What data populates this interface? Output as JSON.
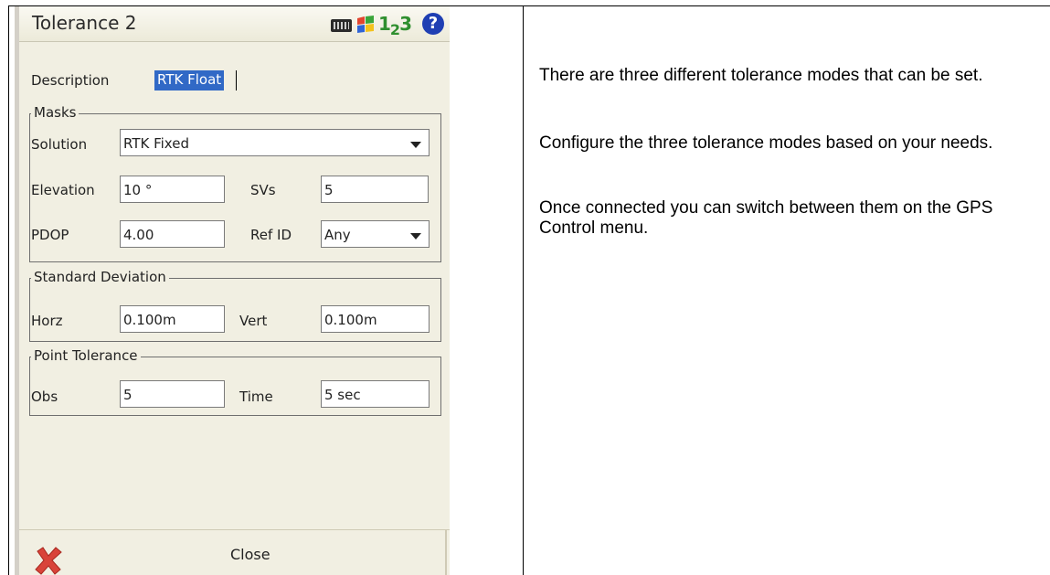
{
  "window": {
    "title": "Tolerance 2"
  },
  "status_icons": [
    "keyboard-icon",
    "windows-flag-icon",
    "input-mode-123-icon",
    "help-icon"
  ],
  "input_mode": {
    "main": "1",
    "sub": "2",
    "tail": "3"
  },
  "help_glyph": "?",
  "description": {
    "label": "Description",
    "value": "RTK Float"
  },
  "masks": {
    "title": "Masks",
    "solution_label": "Solution",
    "solution_value": "RTK Fixed",
    "elevation_label": "Elevation",
    "elevation_value": "10 °",
    "svs_label": "SVs",
    "svs_value": "5",
    "pdop_label": "PDOP",
    "pdop_value": "4.00",
    "refid_label": "Ref ID",
    "refid_value": "Any"
  },
  "std_dev": {
    "title": "Standard Deviation",
    "horz_label": "Horz",
    "horz_value": "0.100m",
    "vert_label": "Vert",
    "vert_value": "0.100m"
  },
  "point_tol": {
    "title": "Point Tolerance",
    "obs_label": "Obs",
    "obs_value": "5",
    "time_label": "Time",
    "time_value": "5 sec"
  },
  "footer": {
    "close_label": "Close"
  },
  "help_text": {
    "p1": "There are three different tolerance modes that can be set.",
    "p2": "Configure the three tolerance modes based on your needs.",
    "p3": "Once connected you can switch between them on the GPS Control menu."
  },
  "colors": {
    "screen_bg": "#f1efe2",
    "selection": "#3169c6",
    "close_x": "#d9443a",
    "help_icon": "#1f3fb3",
    "input_mode": "#2f8f2f"
  }
}
